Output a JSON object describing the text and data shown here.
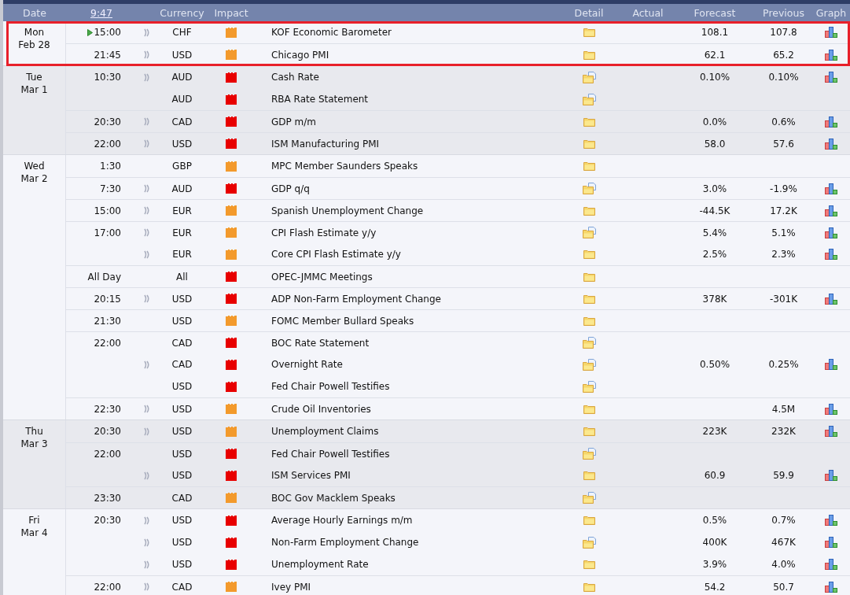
{
  "header": {
    "columns": [
      {
        "kind": "text",
        "label": "Date"
      },
      {
        "kind": "link",
        "label": "9:47"
      },
      {
        "kind": "text",
        "label": "Currency"
      },
      {
        "kind": "text",
        "label": "Impact"
      },
      {
        "kind": "text",
        "label": "Detail"
      },
      {
        "kind": "text",
        "label": "Actual"
      },
      {
        "kind": "text",
        "label": "Forecast"
      },
      {
        "kind": "text",
        "label": "Previous"
      },
      {
        "kind": "text",
        "label": "Graph"
      }
    ]
  },
  "days": [
    {
      "weekday": "Mon",
      "date": "Feb 28",
      "highlighted": true,
      "events": [
        {
          "time": "15:00",
          "next": true,
          "sound": true,
          "currency": "CHF",
          "impact": {
            "color": "#f39a2c"
          },
          "title": "KOF Economic Barometer",
          "document": false,
          "forecast": "108.1",
          "previous": "107.8",
          "graph": true
        },
        {
          "time": "21:45",
          "next": false,
          "sound": true,
          "currency": "USD",
          "impact": {
            "color": "#f39a2c"
          },
          "title": "Chicago PMI",
          "document": false,
          "forecast": "62.1",
          "previous": "65.2",
          "graph": true
        }
      ]
    },
    {
      "weekday": "Tue",
      "date": "Mar 1",
      "highlighted": false,
      "events": [
        {
          "time": "10:30",
          "next": false,
          "sound": true,
          "currency": "AUD",
          "impact": {
            "color": "#e80000"
          },
          "title": "Cash Rate",
          "document": true,
          "forecast": "0.10%",
          "previous": "0.10%",
          "graph": true
        },
        {
          "next": false,
          "sound": false,
          "currency": "AUD",
          "impact": {
            "color": "#e80000"
          },
          "title": "RBA Rate Statement",
          "document": true,
          "graph": false
        },
        {
          "time": "20:30",
          "next": false,
          "sound": true,
          "currency": "CAD",
          "impact": {
            "color": "#e80000"
          },
          "title": "GDP m/m",
          "document": false,
          "forecast": "0.0%",
          "previous": "0.6%",
          "graph": true
        },
        {
          "time": "22:00",
          "next": false,
          "sound": true,
          "currency": "USD",
          "impact": {
            "color": "#e80000"
          },
          "title": "ISM Manufacturing PMI",
          "document": false,
          "forecast": "58.0",
          "previous": "57.6",
          "graph": true
        }
      ]
    },
    {
      "weekday": "Wed",
      "date": "Mar 2",
      "highlighted": false,
      "events": [
        {
          "time": "1:30",
          "next": false,
          "sound": false,
          "currency": "GBP",
          "impact": {
            "color": "#f39a2c"
          },
          "title": "MPC Member Saunders Speaks",
          "document": false,
          "graph": false
        },
        {
          "time": "7:30",
          "next": false,
          "sound": true,
          "currency": "AUD",
          "impact": {
            "color": "#e80000"
          },
          "title": "GDP q/q",
          "document": true,
          "forecast": "3.0%",
          "previous": "-1.9%",
          "graph": true
        },
        {
          "time": "15:00",
          "next": false,
          "sound": true,
          "currency": "EUR",
          "impact": {
            "color": "#f39a2c"
          },
          "title": "Spanish Unemployment Change",
          "document": false,
          "forecast": "-44.5K",
          "previous": "17.2K",
          "graph": true
        },
        {
          "time": "17:00",
          "next": false,
          "sound": true,
          "currency": "EUR",
          "impact": {
            "color": "#f39a2c"
          },
          "title": "CPI Flash Estimate y/y",
          "document": true,
          "forecast": "5.4%",
          "previous": "5.1%",
          "graph": true
        },
        {
          "next": false,
          "sound": true,
          "currency": "EUR",
          "impact": {
            "color": "#f39a2c"
          },
          "title": "Core CPI Flash Estimate y/y",
          "document": false,
          "forecast": "2.5%",
          "previous": "2.3%",
          "graph": true
        },
        {
          "time": "All Day",
          "next": false,
          "sound": false,
          "currency": "All",
          "impact": {
            "color": "#e80000"
          },
          "title": "OPEC-JMMC Meetings",
          "document": false,
          "graph": false
        },
        {
          "time": "20:15",
          "next": false,
          "sound": true,
          "currency": "USD",
          "impact": {
            "color": "#e80000"
          },
          "title": "ADP Non-Farm Employment Change",
          "document": false,
          "forecast": "378K",
          "previous": "-301K",
          "graph": true
        },
        {
          "time": "21:30",
          "next": false,
          "sound": false,
          "currency": "USD",
          "impact": {
            "color": "#f39a2c"
          },
          "title": "FOMC Member Bullard Speaks",
          "document": false,
          "graph": false
        },
        {
          "time": "22:00",
          "next": false,
          "sound": false,
          "currency": "CAD",
          "impact": {
            "color": "#e80000"
          },
          "title": "BOC Rate Statement",
          "document": true,
          "graph": false
        },
        {
          "next": false,
          "sound": true,
          "currency": "CAD",
          "impact": {
            "color": "#e80000"
          },
          "title": "Overnight Rate",
          "document": true,
          "forecast": "0.50%",
          "previous": "0.25%",
          "graph": true
        },
        {
          "next": false,
          "sound": false,
          "currency": "USD",
          "impact": {
            "color": "#e80000"
          },
          "title": "Fed Chair Powell Testifies",
          "document": true,
          "graph": false
        },
        {
          "time": "22:30",
          "next": false,
          "sound": true,
          "currency": "USD",
          "impact": {
            "color": "#f39a2c"
          },
          "title": "Crude Oil Inventories",
          "document": false,
          "previous": "4.5M",
          "graph": true
        }
      ]
    },
    {
      "weekday": "Thu",
      "date": "Mar 3",
      "highlighted": false,
      "events": [
        {
          "time": "20:30",
          "next": false,
          "sound": true,
          "currency": "USD",
          "impact": {
            "color": "#f39a2c"
          },
          "title": "Unemployment Claims",
          "document": false,
          "forecast": "223K",
          "previous": "232K",
          "graph": true
        },
        {
          "time": "22:00",
          "next": false,
          "sound": false,
          "currency": "USD",
          "impact": {
            "color": "#e80000"
          },
          "title": "Fed Chair Powell Testifies",
          "document": true,
          "graph": false
        },
        {
          "next": false,
          "sound": true,
          "currency": "USD",
          "impact": {
            "color": "#e80000"
          },
          "title": "ISM Services PMI",
          "document": false,
          "forecast": "60.9",
          "previous": "59.9",
          "graph": true
        },
        {
          "time": "23:30",
          "next": false,
          "sound": false,
          "currency": "CAD",
          "impact": {
            "color": "#f39a2c"
          },
          "title": "BOC Gov Macklem Speaks",
          "document": true,
          "graph": false
        }
      ]
    },
    {
      "weekday": "Fri",
      "date": "Mar 4",
      "highlighted": false,
      "events": [
        {
          "time": "20:30",
          "next": false,
          "sound": true,
          "currency": "USD",
          "impact": {
            "color": "#e80000"
          },
          "title": "Average Hourly Earnings m/m",
          "document": false,
          "forecast": "0.5%",
          "previous": "0.7%",
          "graph": true
        },
        {
          "next": false,
          "sound": true,
          "currency": "USD",
          "impact": {
            "color": "#e80000"
          },
          "title": "Non-Farm Employment Change",
          "document": true,
          "forecast": "400K",
          "previous": "467K",
          "graph": true
        },
        {
          "next": false,
          "sound": true,
          "currency": "USD",
          "impact": {
            "color": "#e80000"
          },
          "title": "Unemployment Rate",
          "document": false,
          "forecast": "3.9%",
          "previous": "4.0%",
          "graph": true
        },
        {
          "time": "22:00",
          "next": false,
          "sound": true,
          "currency": "CAD",
          "impact": {
            "color": "#f39a2c"
          },
          "title": "Ivey PMI",
          "document": false,
          "forecast": "54.2",
          "previous": "50.7",
          "graph": true
        }
      ]
    }
  ]
}
